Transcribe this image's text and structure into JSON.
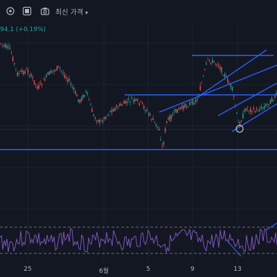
{
  "toolbar": {
    "icons": [
      "settings-icon",
      "grid-icon",
      "camera-icon"
    ],
    "price_type": "최신 가격"
  },
  "price_change": "94.1 (+0.19%)",
  "xaxis": {
    "ticks": [
      "25",
      "6월",
      "5",
      "9",
      "13"
    ]
  },
  "colors": {
    "background": "#131722",
    "up": "#26a69a",
    "down": "#ef5350",
    "trendline": "#2962ff",
    "rsi": "#7e57c2"
  }
}
